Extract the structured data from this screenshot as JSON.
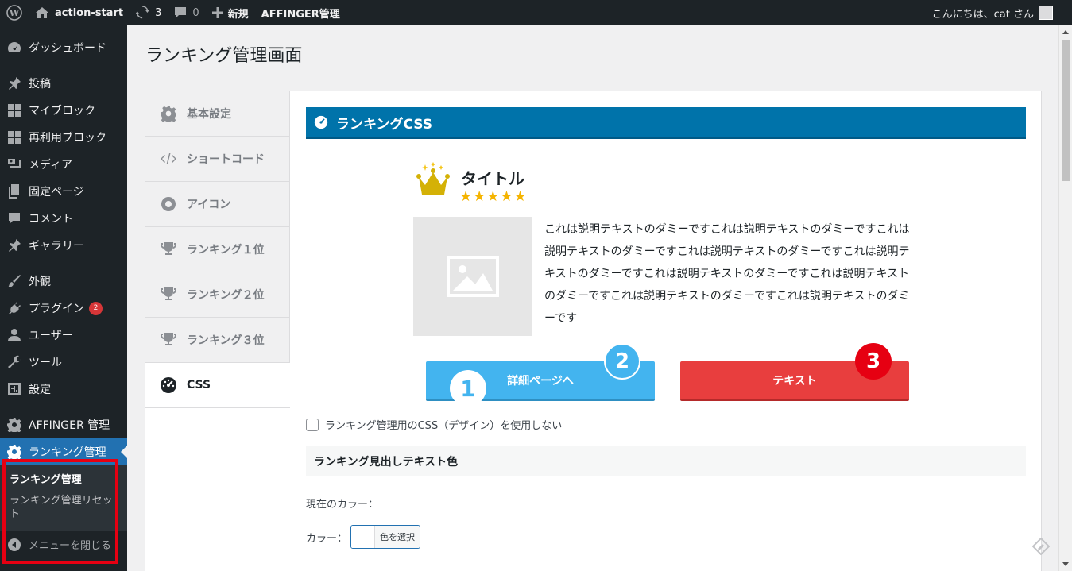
{
  "adminbar": {
    "site_name": "action-start",
    "updates_count": "3",
    "comments_count": "0",
    "new_label": "新規",
    "affinger_label": "AFFINGER管理",
    "greeting": "こんにちは、cat さん"
  },
  "sidebar": {
    "items": [
      {
        "label": "ダッシュボード",
        "icon": "dashboard-icon"
      },
      {
        "label": "投稿",
        "icon": "pin-icon"
      },
      {
        "label": "マイブロック",
        "icon": "grid-icon"
      },
      {
        "label": "再利用ブロック",
        "icon": "grid-icon"
      },
      {
        "label": "メディア",
        "icon": "media-icon"
      },
      {
        "label": "固定ページ",
        "icon": "page-icon"
      },
      {
        "label": "コメント",
        "icon": "comment-icon"
      },
      {
        "label": "ギャラリー",
        "icon": "pin-icon"
      },
      {
        "label": "外観",
        "icon": "brush-icon"
      },
      {
        "label": "プラグイン",
        "icon": "plugin-icon",
        "badge": "2"
      },
      {
        "label": "ユーザー",
        "icon": "user-icon"
      },
      {
        "label": "ツール",
        "icon": "wrench-icon"
      },
      {
        "label": "設定",
        "icon": "settings-icon"
      },
      {
        "label": "AFFINGER 管理",
        "icon": "gear-icon"
      },
      {
        "label": "ランキング管理",
        "icon": "gear-icon"
      }
    ],
    "submenu": [
      "ランキング管理",
      "ランキング管理リセット"
    ],
    "collapse_label": "メニューを閉じる"
  },
  "page_title": "ランキング管理画面",
  "tabs": [
    {
      "label": "基本設定",
      "icon": "gear-icon"
    },
    {
      "label": "ショートコード",
      "icon": "code-icon"
    },
    {
      "label": "アイコン",
      "icon": "eye-icon"
    },
    {
      "label": "ランキング１位",
      "icon": "trophy-icon"
    },
    {
      "label": "ランキング２位",
      "icon": "trophy-icon"
    },
    {
      "label": "ランキング３位",
      "icon": "trophy-icon"
    },
    {
      "label": "CSS",
      "icon": "gauge-icon"
    }
  ],
  "section_title": "ランキングCSS",
  "preview": {
    "title": "タイトル",
    "stars": "★★★★★",
    "description": "これは説明テキストのダミーですこれは説明テキストのダミーですこれは説明テキストのダミーですこれは説明テキストのダミーですこれは説明テキストのダミーですこれは説明テキストのダミーですこれは説明テキストのダミーですこれは説明テキストのダミーですこれは説明テキストのダミーです",
    "button_blue": "詳細ページへ",
    "button_red": "テキスト",
    "marker_1": "1",
    "marker_2": "2",
    "marker_3": "3"
  },
  "option_disable_css": "ランキング管理用のCSS（デザイン）を使用しない",
  "subsection_title": "ランキング見出しテキスト色",
  "current_color_label": "現在のカラー：",
  "color_label": "カラー：",
  "color_button": "色を選択",
  "colors": {
    "adminbar": "#1d2327",
    "accent": "#0073aa",
    "current_menu": "#2271b1",
    "highlight": "#e60012",
    "button_blue": "#43b4ef",
    "button_red": "#e83e3e",
    "stars": "#f5b400"
  }
}
